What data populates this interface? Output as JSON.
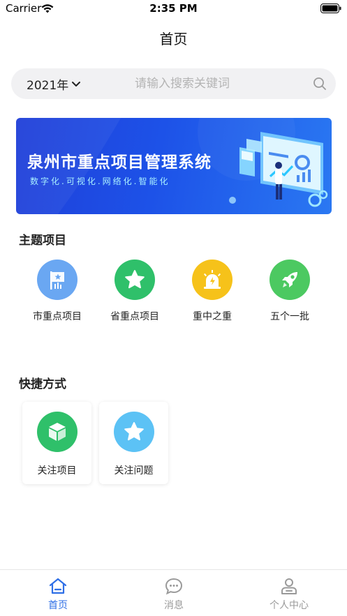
{
  "status_bar": {
    "carrier": "Carrier",
    "time": "2:35 PM"
  },
  "nav": {
    "title": "首页"
  },
  "search": {
    "year": "2021年",
    "placeholder": "请输入搜索关键词"
  },
  "banner": {
    "title": "泉州市重点项目管理系统",
    "subtitle": "数字化.可视化.网络化.智能化"
  },
  "theme_section": {
    "title": "主题项目",
    "items": [
      {
        "label": "市重点项目",
        "icon": "flag-icon",
        "color": "#6aa7f2"
      },
      {
        "label": "省重点项目",
        "icon": "star-icon",
        "color": "#2fc06a"
      },
      {
        "label": "重中之重",
        "icon": "alarm-icon",
        "color": "#f6c21a"
      },
      {
        "label": "五个一批",
        "icon": "rocket-icon",
        "color": "#4cc961"
      }
    ]
  },
  "shortcut_section": {
    "title": "快捷方式",
    "items": [
      {
        "label": "关注项目",
        "icon": "cube-icon",
        "color": "#2fc06a"
      },
      {
        "label": "关注问题",
        "icon": "star-icon",
        "color": "#5cc2f5"
      }
    ]
  },
  "tabs": [
    {
      "label": "首页",
      "icon": "home-icon",
      "active": true
    },
    {
      "label": "消息",
      "icon": "chat-icon",
      "active": false
    },
    {
      "label": "个人中心",
      "icon": "user-icon",
      "active": false
    }
  ],
  "colors": {
    "accent": "#2f6fe6",
    "banner": "#1f47de",
    "tab_inactive": "#9a9a9a"
  }
}
